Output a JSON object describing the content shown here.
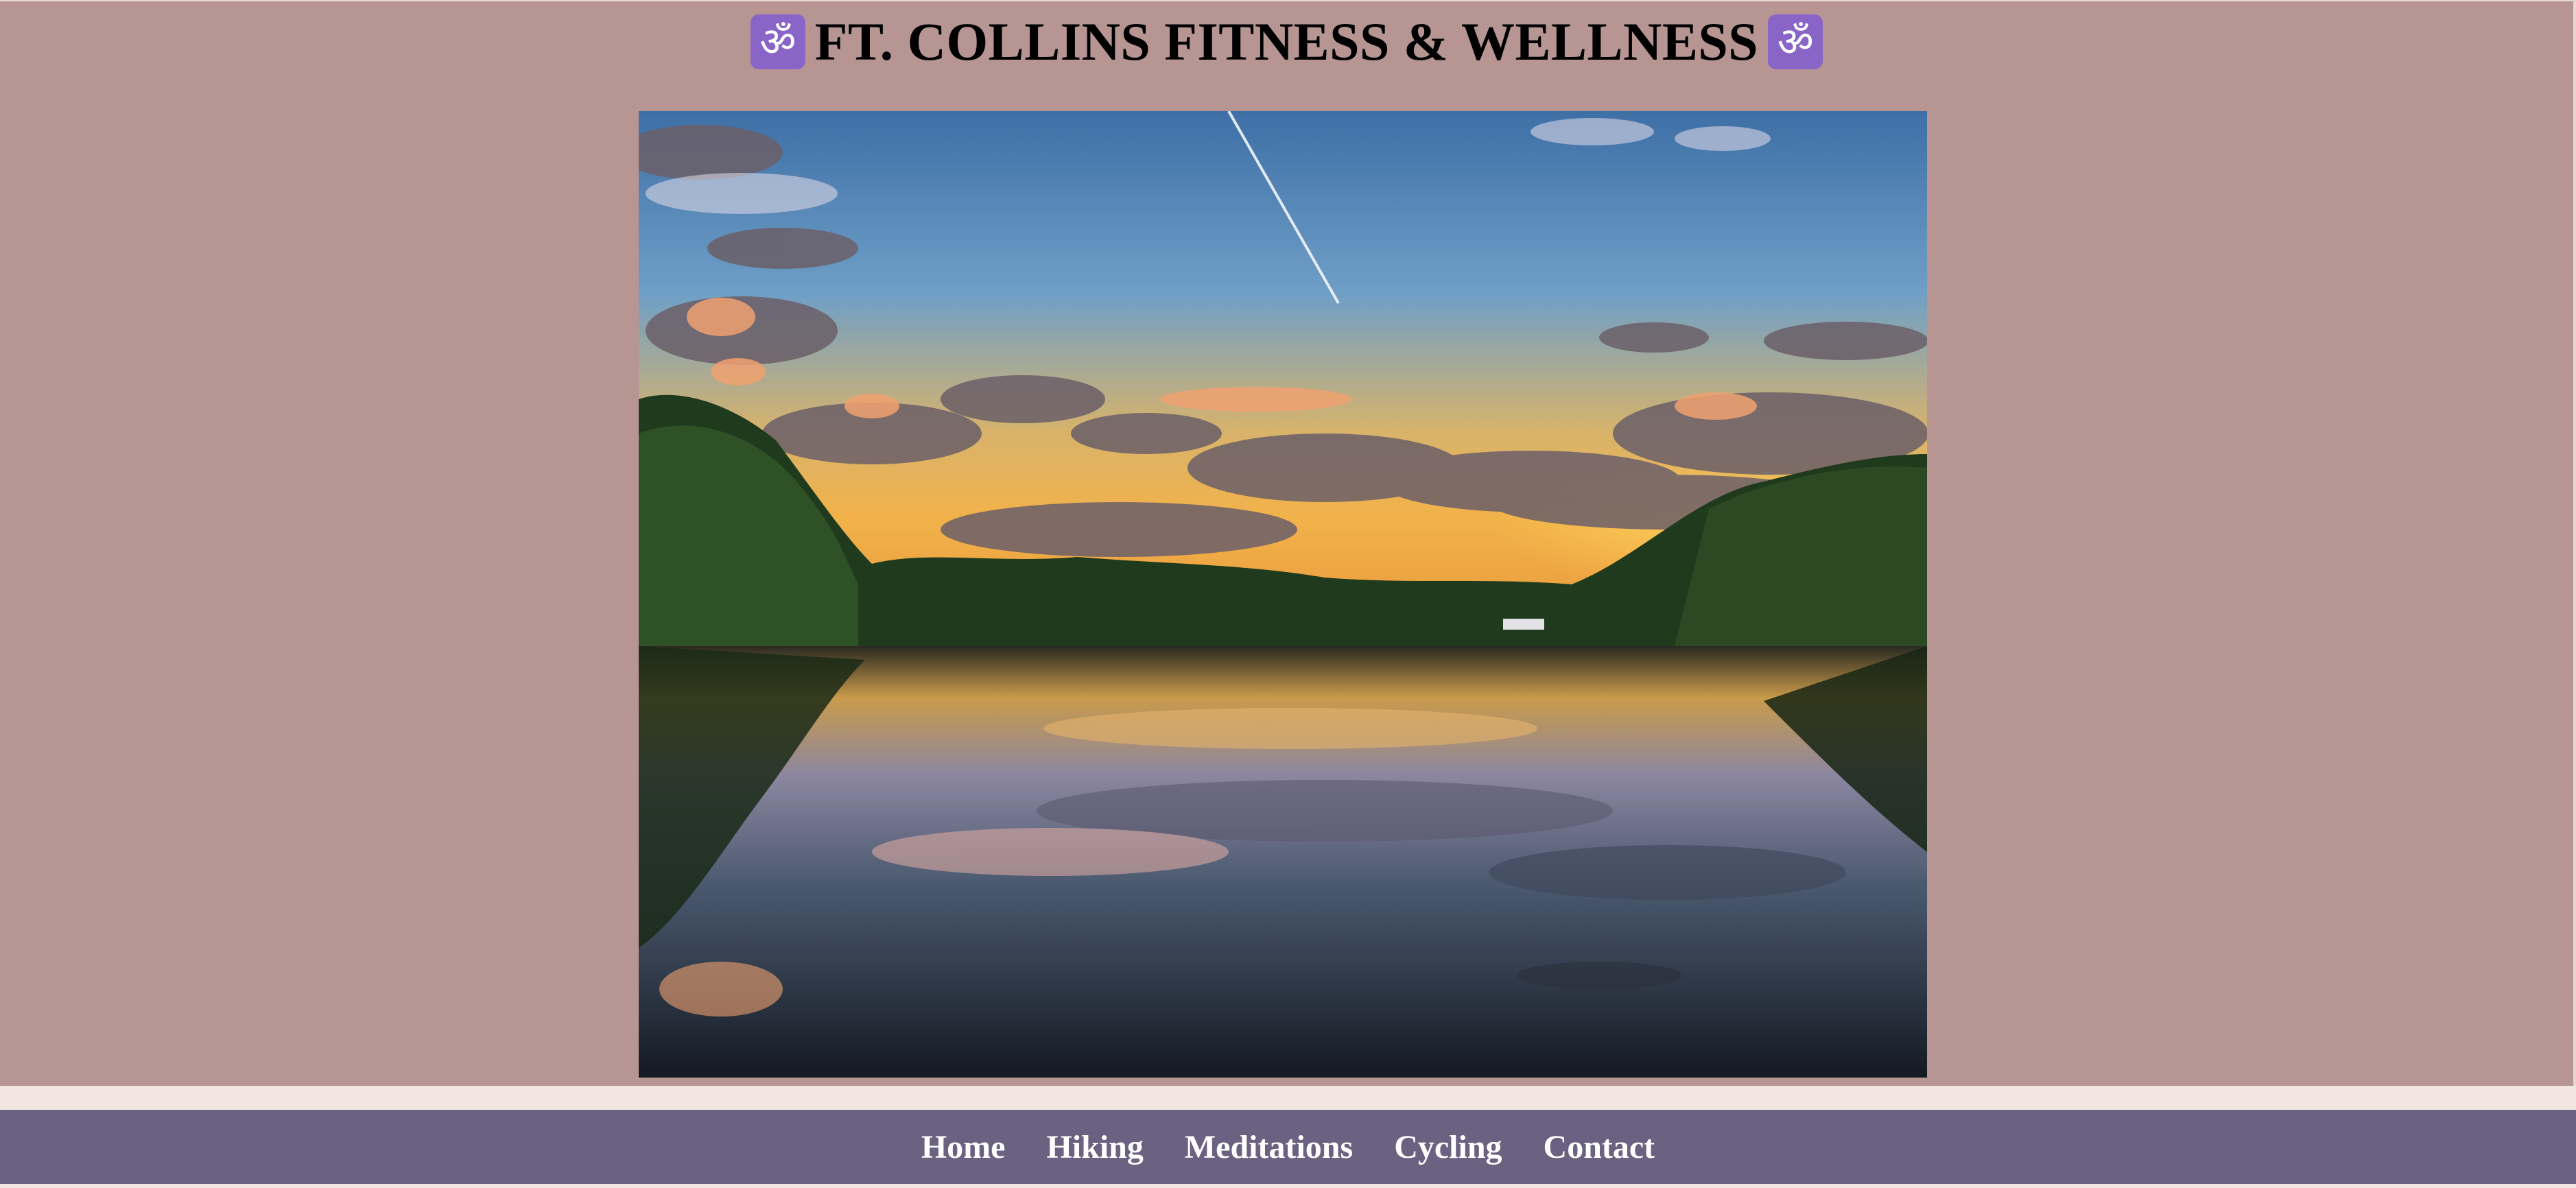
{
  "header": {
    "title": "FT. COLLINS FITNESS & WELLNESS",
    "icon_left": "om-icon",
    "icon_right": "om-icon",
    "icon_glyph": "ॐ"
  },
  "hero": {
    "image": "lake-sunset-photo"
  },
  "nav": {
    "items": [
      {
        "label": "Home"
      },
      {
        "label": "Hiking"
      },
      {
        "label": "Meditations"
      },
      {
        "label": "Cycling"
      },
      {
        "label": "Contact"
      }
    ]
  },
  "colors": {
    "page_background": "#b69593",
    "nav_background": "#6a6280",
    "strip_background": "#f1e7e0",
    "icon_badge": "#8a65c8",
    "title_text": "#000000",
    "nav_text": "#ffffff"
  }
}
